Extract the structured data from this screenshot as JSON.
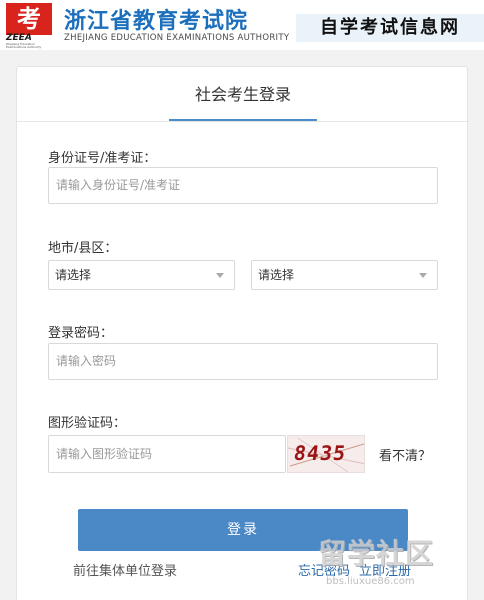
{
  "header": {
    "logo_glyph": "考",
    "logo_abbr": "ZEEA",
    "logo_fine_text": "Zhejiang Education Examinations Authority",
    "org_name": "浙江省教育考试院",
    "org_name_en": "ZHEJIANG EDUCATION EXAMINATIONS AUTHORITY",
    "site_name": "自学考试信息网",
    "brand_color": "#1c6fbc"
  },
  "login": {
    "tab_title": "社会考生登录",
    "id_label": "身份证号/准考证：",
    "id_placeholder": "请输入身份证号/准考证",
    "region_label": "地市/县区：",
    "city_select": "请选择",
    "county_select": "请选择",
    "password_label": "登录密码：",
    "password_placeholder": "请输入密码",
    "captcha_label": "图形验证码：",
    "captcha_placeholder": "请输入图形验证码",
    "captcha_code": "8435",
    "refresh_text": "看不清？",
    "submit_label": "登录",
    "group_login_link": "前往集体单位登录",
    "forgot_link": "忘记密码",
    "register_link": "立即注册",
    "accent_color": "#4a88c6"
  },
  "watermark": {
    "title": "留学社区",
    "url": "bbs.liuxue86.com"
  }
}
